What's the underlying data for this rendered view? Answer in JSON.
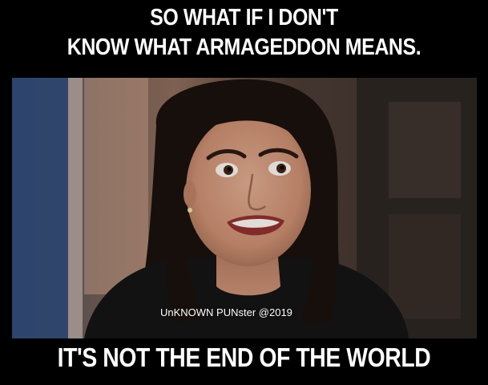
{
  "meme": {
    "top_text_line1": "SO WHAT IF I DON'T",
    "top_text_line2": "KNOW WHAT ARMAGEDDON MEANS.",
    "bottom_text": "IT'S NOT THE END OF THE WORLD",
    "watermark": "UnKNOWN PUNster @2019"
  },
  "colors": {
    "background": "#000000",
    "caption_text": "#ffffff"
  }
}
